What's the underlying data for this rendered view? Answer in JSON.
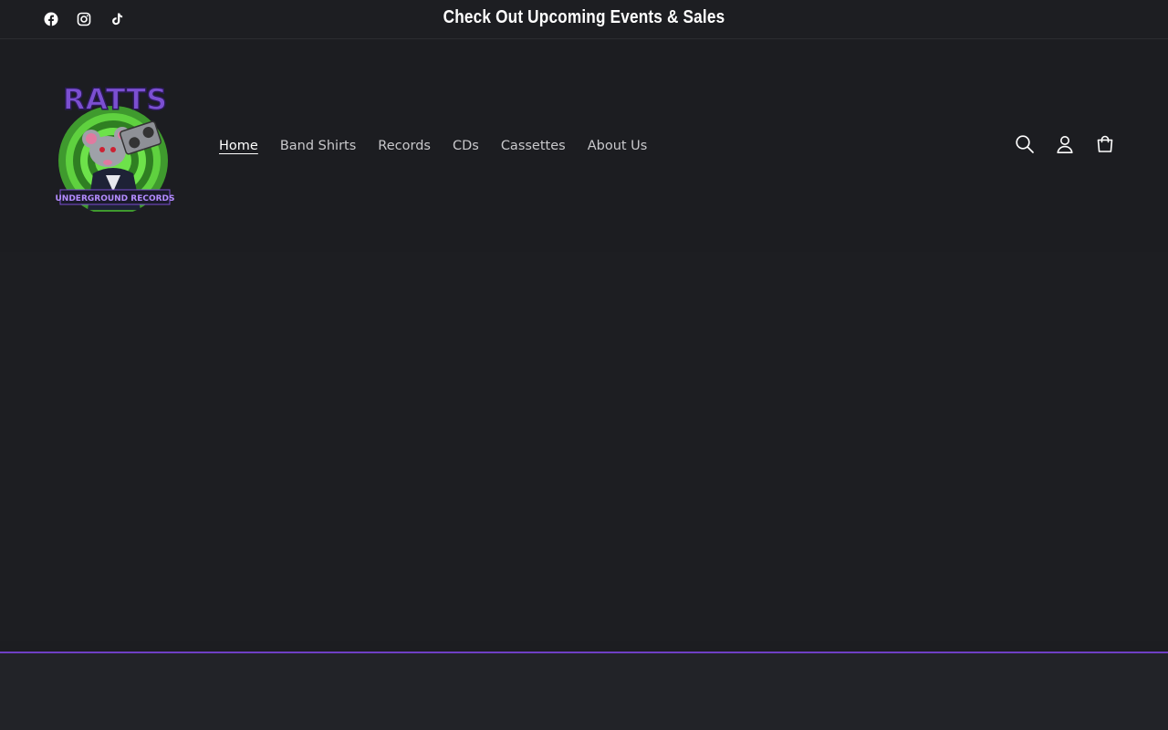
{
  "announcement": {
    "text": "Check Out Upcoming Events & Sales",
    "social_icons": [
      "facebook-icon",
      "instagram-icon",
      "tiktok-icon"
    ]
  },
  "header": {
    "logo": {
      "top_text": "RATTS",
      "bottom_text": "UNDERGROUND RECORDS"
    },
    "nav": [
      {
        "label": "Home",
        "active": true
      },
      {
        "label": "Band Shirts"
      },
      {
        "label": "Records"
      },
      {
        "label": "CDs"
      },
      {
        "label": "Cassettes"
      },
      {
        "label": "About Us"
      }
    ],
    "icons": [
      "search-icon",
      "account-icon",
      "cart-icon"
    ]
  },
  "colors": {
    "background": "#1c1d21",
    "accent": "#6f3fc4",
    "text": "#ffffff"
  }
}
